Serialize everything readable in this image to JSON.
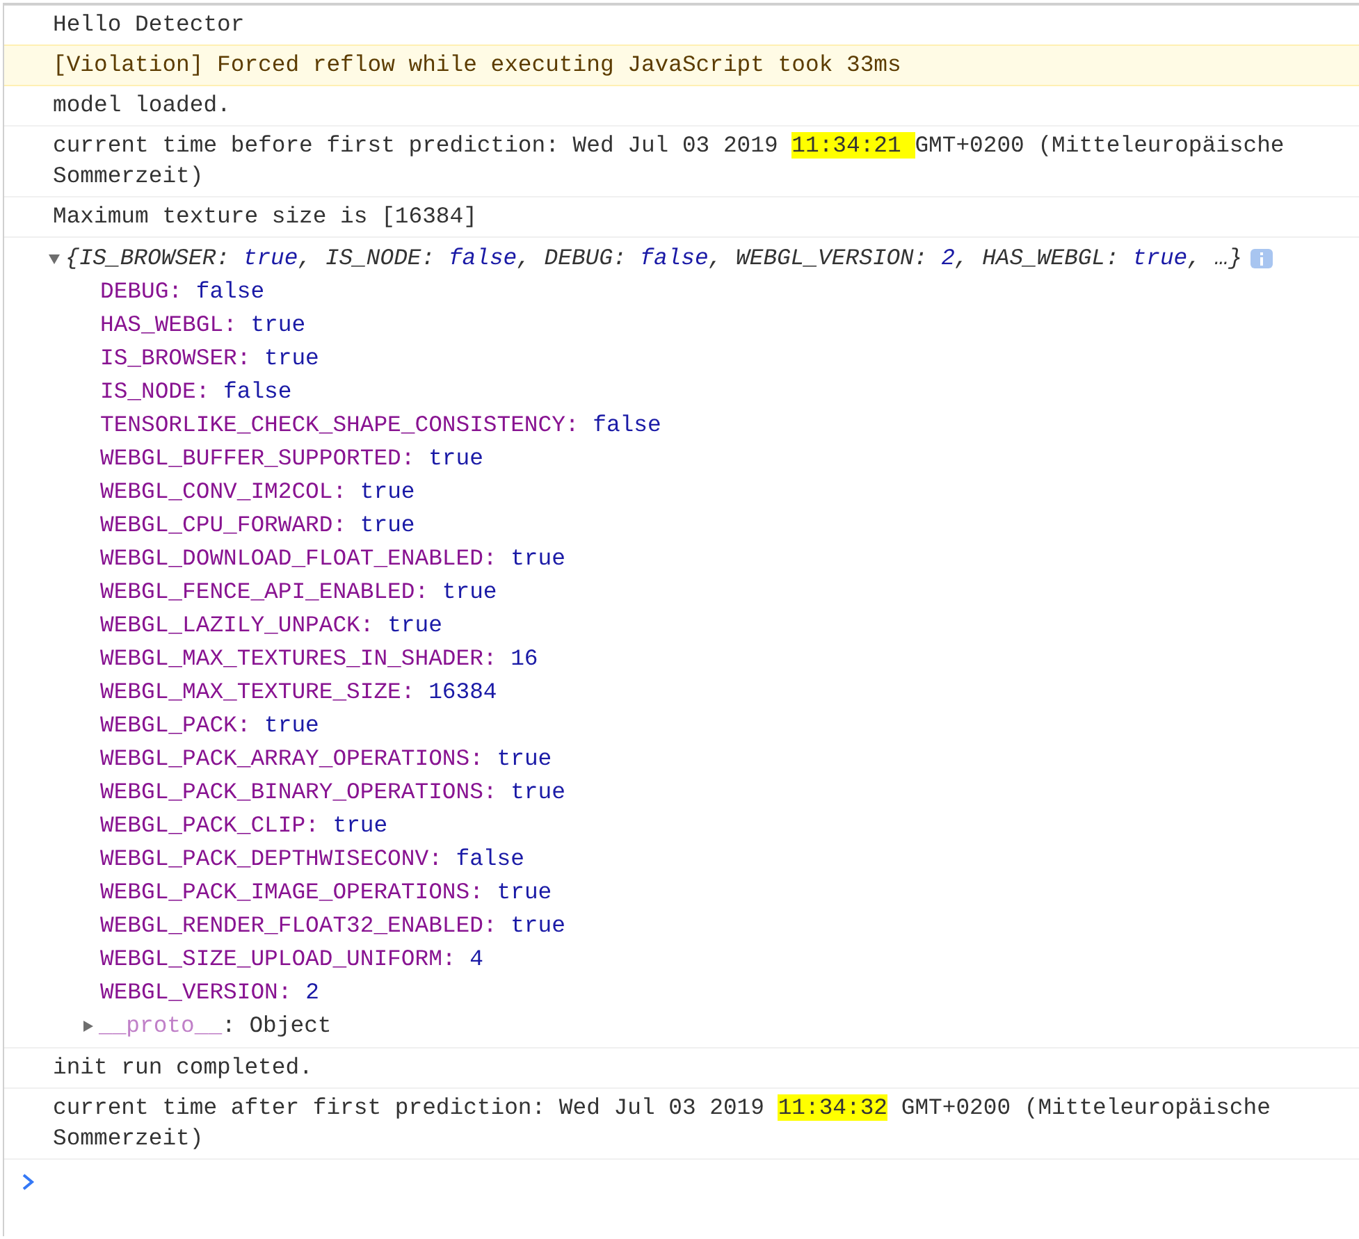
{
  "messages": [
    {
      "kind": "log",
      "segments": [
        {
          "text": "Hello Detector",
          "highlighted": false
        }
      ]
    },
    {
      "kind": "violation",
      "segments": [
        {
          "text": "[Violation] Forced reflow while executing JavaScript took 33ms",
          "highlighted": false
        }
      ]
    },
    {
      "kind": "log",
      "segments": [
        {
          "text": "model loaded.",
          "highlighted": false
        }
      ]
    },
    {
      "kind": "log",
      "segments": [
        {
          "text": "current time before first prediction: Wed Jul 03 2019 ",
          "highlighted": false
        },
        {
          "text": "11:34:21 ",
          "highlighted": true
        },
        {
          "text": "GMT+0200 (Mitteleuropäische Sommerzeit)",
          "highlighted": false
        }
      ]
    },
    {
      "kind": "log",
      "segments": [
        {
          "text": "Maximum texture size is [16384]",
          "highlighted": false
        }
      ]
    },
    {
      "kind": "object",
      "expanded": true,
      "summary": [
        {
          "text": "{IS_BROWSER: ",
          "kind": "key"
        },
        {
          "text": "true",
          "kind": "value"
        },
        {
          "text": ", IS_NODE: ",
          "kind": "key"
        },
        {
          "text": "false",
          "kind": "value"
        },
        {
          "text": ", DEBUG: ",
          "kind": "key"
        },
        {
          "text": "false",
          "kind": "value"
        },
        {
          "text": ", WEBGL_VERSION: ",
          "kind": "key"
        },
        {
          "text": "2",
          "kind": "value"
        },
        {
          "text": ", HAS_WEBGL: ",
          "kind": "key"
        },
        {
          "text": "true",
          "kind": "value"
        },
        {
          "text": ", …}",
          "kind": "key"
        }
      ],
      "properties": [
        {
          "key": "DEBUG:",
          "value": "false"
        },
        {
          "key": "HAS_WEBGL:",
          "value": "true"
        },
        {
          "key": "IS_BROWSER:",
          "value": "true"
        },
        {
          "key": "IS_NODE:",
          "value": "false"
        },
        {
          "key": "TENSORLIKE_CHECK_SHAPE_CONSISTENCY:",
          "value": "false"
        },
        {
          "key": "WEBGL_BUFFER_SUPPORTED:",
          "value": "true"
        },
        {
          "key": "WEBGL_CONV_IM2COL:",
          "value": "true"
        },
        {
          "key": "WEBGL_CPU_FORWARD:",
          "value": "true"
        },
        {
          "key": "WEBGL_DOWNLOAD_FLOAT_ENABLED:",
          "value": "true"
        },
        {
          "key": "WEBGL_FENCE_API_ENABLED:",
          "value": "true"
        },
        {
          "key": "WEBGL_LAZILY_UNPACK:",
          "value": "true"
        },
        {
          "key": "WEBGL_MAX_TEXTURES_IN_SHADER:",
          "value": "16"
        },
        {
          "key": "WEBGL_MAX_TEXTURE_SIZE:",
          "value": "16384"
        },
        {
          "key": "WEBGL_PACK:",
          "value": "true"
        },
        {
          "key": "WEBGL_PACK_ARRAY_OPERATIONS:",
          "value": "true"
        },
        {
          "key": "WEBGL_PACK_BINARY_OPERATIONS:",
          "value": "true"
        },
        {
          "key": "WEBGL_PACK_CLIP:",
          "value": "true"
        },
        {
          "key": "WEBGL_PACK_DEPTHWISECONV:",
          "value": "false"
        },
        {
          "key": "WEBGL_PACK_IMAGE_OPERATIONS:",
          "value": "true"
        },
        {
          "key": "WEBGL_RENDER_FLOAT32_ENABLED:",
          "value": "true"
        },
        {
          "key": "WEBGL_SIZE_UPLOAD_UNIFORM:",
          "value": "4"
        },
        {
          "key": "WEBGL_VERSION:",
          "value": "2"
        }
      ],
      "proto": {
        "key": "__proto__",
        "colon": ":",
        "value": "Object",
        "expanded": false
      }
    },
    {
      "kind": "log",
      "segments": [
        {
          "text": "init run completed.",
          "highlighted": false
        }
      ]
    },
    {
      "kind": "log",
      "segments": [
        {
          "text": "current time after first prediction: Wed Jul 03 2019 ",
          "highlighted": false
        },
        {
          "text": "11:34:32",
          "highlighted": true
        },
        {
          "text": " GMT+0200 (Mitteleuropäische Sommerzeit)",
          "highlighted": false
        }
      ]
    }
  ]
}
